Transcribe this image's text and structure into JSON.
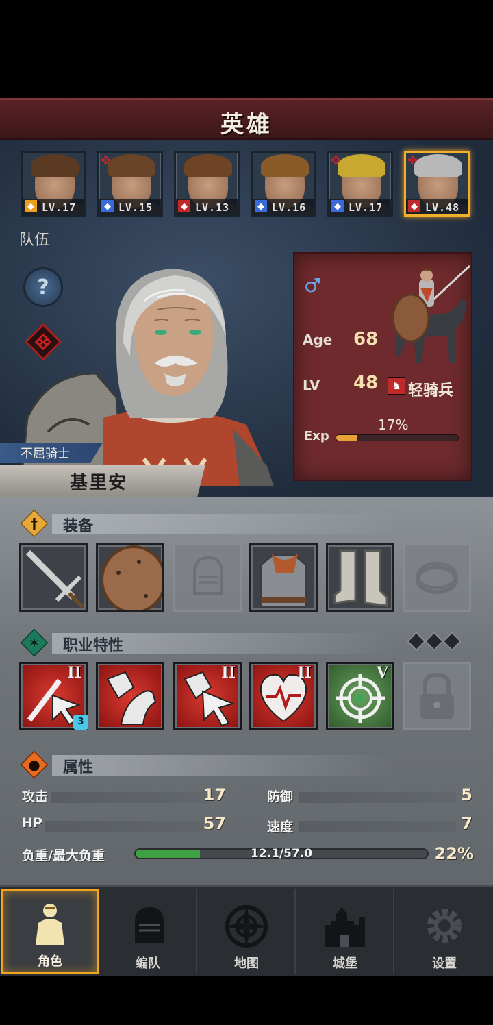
{
  "title": "英雄",
  "roster": [
    {
      "level_text": "LV.17",
      "class_color": "#e8a020",
      "hair": "#5a3a22",
      "flag": false,
      "selected": false
    },
    {
      "level_text": "LV.15",
      "class_color": "#3a6ad8",
      "hair": "#6a4428",
      "flag": true,
      "selected": false
    },
    {
      "level_text": "LV.13",
      "class_color": "#c02a2a",
      "hair": "#6e4424",
      "flag": false,
      "selected": false
    },
    {
      "level_text": "LV.16",
      "class_color": "#3a6ad8",
      "hair": "#8a5a28",
      "flag": false,
      "selected": false
    },
    {
      "level_text": "LV.17",
      "class_color": "#3a6ad8",
      "hair": "#c8a830",
      "flag": true,
      "selected": false
    },
    {
      "level_text": "LV.48",
      "class_color": "#c02a2a",
      "hair": "#b8b8b8",
      "flag": true,
      "selected": true
    }
  ],
  "team_label": "队伍",
  "help_glyph": "?",
  "hero": {
    "title": "不屈骑士",
    "name": "基里安",
    "gender_symbol": "♂",
    "age_label": "Age",
    "age": "68",
    "lv_label": "LV",
    "level": "48",
    "class_name": "轻骑兵",
    "exp_label": "Exp",
    "exp_percent_text": "17%",
    "exp_fraction": 0.17
  },
  "equipment": {
    "label": "装备",
    "glyph": "†",
    "slots": [
      "sword",
      "round-shield",
      "helmet-empty",
      "chainmail-armor",
      "chain-boots",
      "ring-empty"
    ]
  },
  "traits": {
    "label": "职业特性",
    "glyph": "✶",
    "items": [
      {
        "icon": "sword-cursor",
        "rank": "II",
        "badge": "3"
      },
      {
        "icon": "shield-horse",
        "rank": "",
        "badge": ""
      },
      {
        "icon": "shield-cursor",
        "rank": "II",
        "badge": ""
      },
      {
        "icon": "heart-pulse",
        "rank": "II",
        "badge": ""
      },
      {
        "icon": "crosshair-clover",
        "rank": "V",
        "badge": ""
      },
      {
        "icon": "lock",
        "rank": "",
        "badge": ""
      }
    ]
  },
  "attributes": {
    "label": "属性",
    "attack_label": "攻击",
    "attack": "17",
    "defense_label": "防御",
    "defense": "5",
    "hp_label": "HP",
    "hp": "57",
    "speed_label": "速度",
    "speed": "7",
    "load_label": "负重/最大负重",
    "load_text": "12.1/57.0",
    "load_percent": "22%",
    "load_fraction": 0.22
  },
  "nav": [
    {
      "label": "角色",
      "icon": "knight-icon",
      "active": true
    },
    {
      "label": "编队",
      "icon": "helmet-squad-icon",
      "active": false
    },
    {
      "label": "地图",
      "icon": "compass-icon",
      "active": false
    },
    {
      "label": "城堡",
      "icon": "castle-icon",
      "active": false
    },
    {
      "label": "设置",
      "icon": "gear-icon",
      "active": false
    }
  ],
  "colors": {
    "accent": "#f2a51e",
    "panel_red": "#6e2a2c",
    "title_red": "#4a1c1e",
    "load_green": "#3fa044"
  }
}
